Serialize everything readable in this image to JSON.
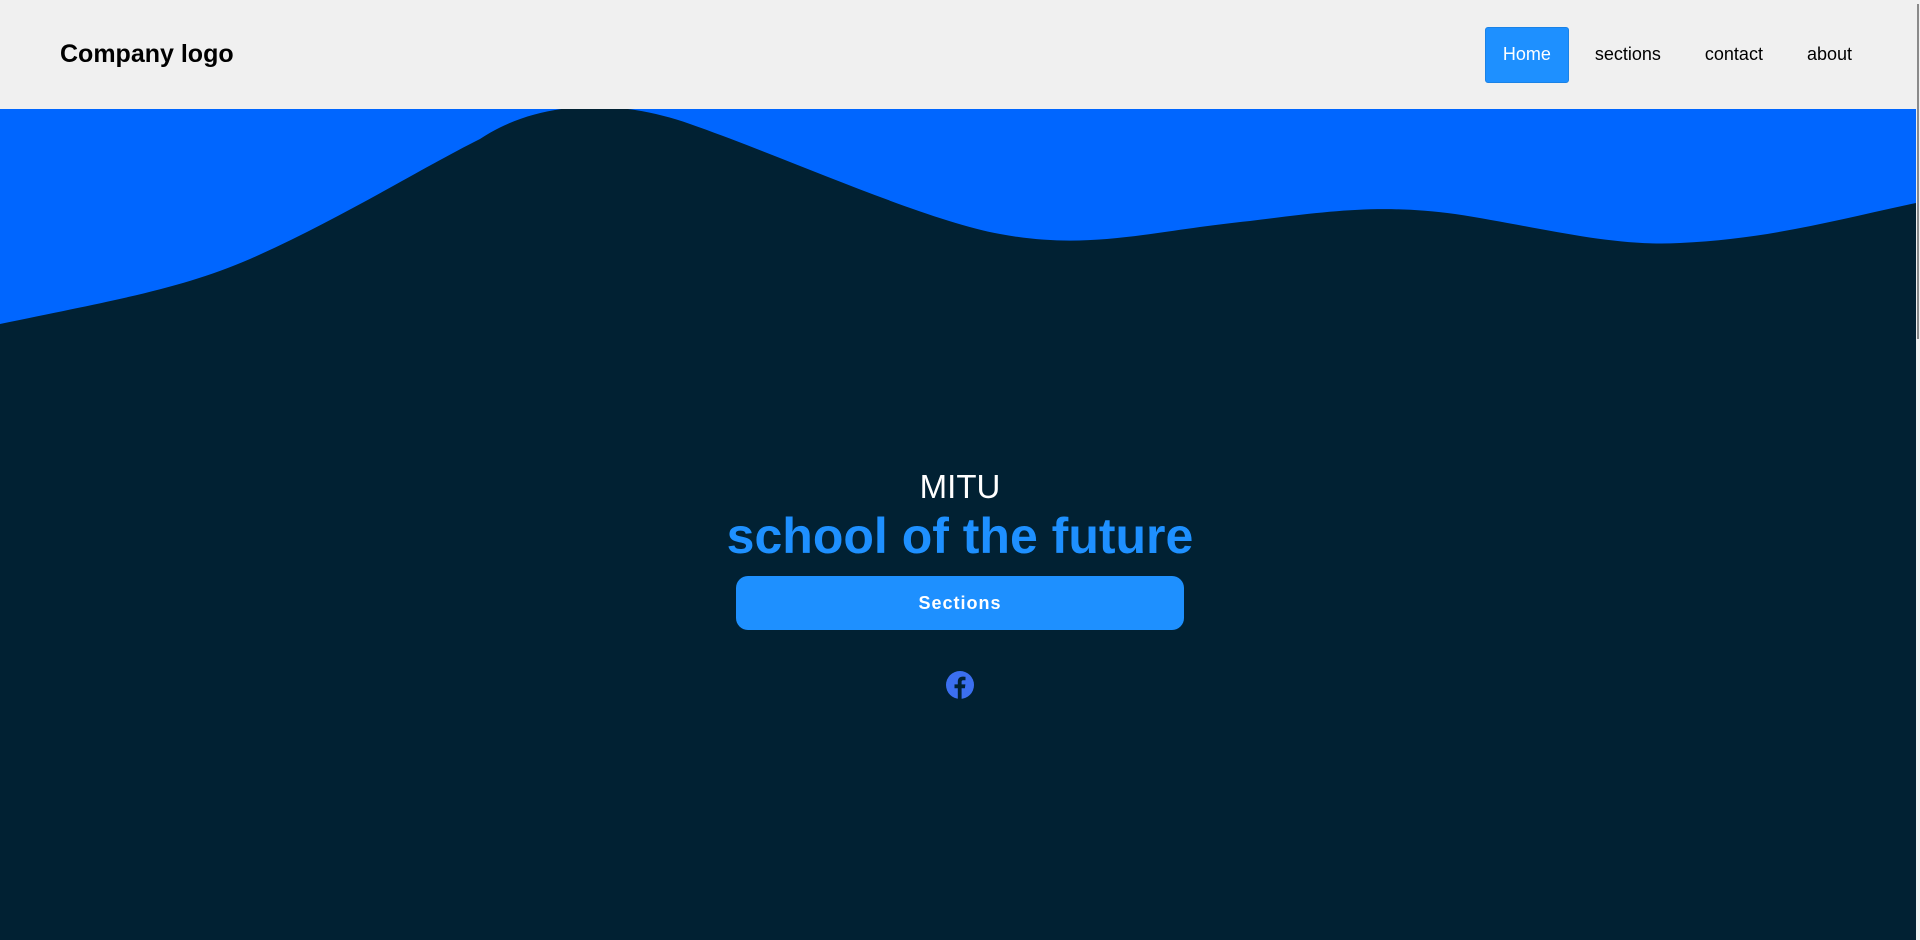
{
  "header": {
    "logo_text": "Company logo",
    "nav": [
      {
        "label": "Home",
        "active": true
      },
      {
        "label": "sections",
        "active": false
      },
      {
        "label": "contact",
        "active": false
      },
      {
        "label": "about",
        "active": false
      }
    ]
  },
  "hero": {
    "kicker": "MITU",
    "title": "school of the future",
    "button_label": "Sections",
    "social_icon": "facebook-icon"
  },
  "colors": {
    "header_bg": "#f0f0f0",
    "accent": "#1e90ff",
    "wave_blue": "#0066ff",
    "hero_bg": "#012133",
    "facebook_blue": "#3b6ff0"
  }
}
